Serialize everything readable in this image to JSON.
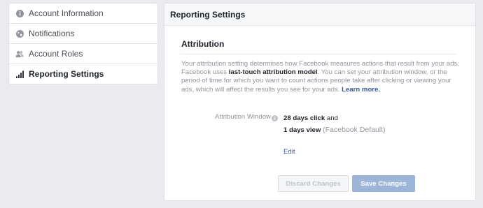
{
  "sidebar": {
    "items": [
      {
        "label": "Account Information",
        "icon": "info-circle-icon"
      },
      {
        "label": "Notifications",
        "icon": "globe-icon"
      },
      {
        "label": "Account Roles",
        "icon": "people-icon"
      },
      {
        "label": "Reporting Settings",
        "icon": "bar-chart-icon",
        "active": true
      }
    ]
  },
  "panel": {
    "title": "Reporting Settings",
    "section_title": "Attribution",
    "description": {
      "part1": "Your attribution setting determines how Facebook measures actions that result from your ads. Facebook uses ",
      "bold": "last-touch attribution model",
      "part2": ". You can set your attribution window, or the period of time for which you want to count actions people take after clicking or viewing your ads, which will affect the results you see for your ads. ",
      "link": "Learn more."
    },
    "attribution_window": {
      "label": "Attribution Window",
      "click_value": "28 days click",
      "and": " and",
      "view_value": "1 days view",
      "default_note": " (Facebook Default)"
    },
    "edit_label": "Edit",
    "buttons": {
      "discard": "Discard Changes",
      "save": "Save Changes"
    }
  },
  "colors": {
    "background": "#e9ebee",
    "link": "#365899",
    "save_button": "#9cb4d8",
    "muted_text": "#90949c"
  }
}
